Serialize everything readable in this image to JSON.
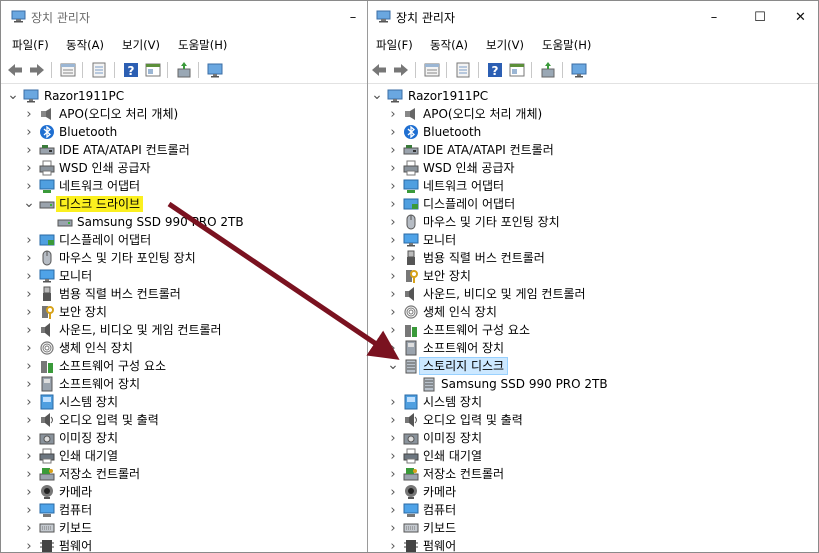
{
  "window": {
    "title": "장치 관리자",
    "menu": [
      "파일(F)",
      "동작(A)",
      "보기(V)",
      "도움말(H)"
    ],
    "controls": {
      "minimize": "–",
      "maximize": "☐",
      "close": "✕"
    }
  },
  "colors": {
    "arrow": "#7a1220",
    "highlight_yellow": "#fbf01f",
    "selection_blue": "#cce8ff"
  },
  "left_tree": {
    "root": "Razor1911PC",
    "items": [
      {
        "label": "APO(오디오 처리 개체)",
        "icon": "audio-processing-icon"
      },
      {
        "label": "Bluetooth",
        "icon": "bluetooth-icon"
      },
      {
        "label": "IDE ATA/ATAPI 컨트롤러",
        "icon": "ide-controller-icon"
      },
      {
        "label": "WSD 인쇄 공급자",
        "icon": "printer-icon"
      },
      {
        "label": "네트워크 어댑터",
        "icon": "network-adapter-icon"
      },
      {
        "label": "디스크 드라이브",
        "icon": "disk-drive-icon",
        "expanded": true,
        "highlight": "yellow"
      },
      {
        "label": "Samsung SSD 990 PRO 2TB",
        "icon": "disk-drive-icon",
        "child": true
      },
      {
        "label": "디스플레이 어댑터",
        "icon": "display-adapter-icon"
      },
      {
        "label": "마우스 및 기타 포인팅 장치",
        "icon": "mouse-icon"
      },
      {
        "label": "모니터",
        "icon": "monitor-icon"
      },
      {
        "label": "범용 직렬 버스 컨트롤러",
        "icon": "usb-controller-icon"
      },
      {
        "label": "보안 장치",
        "icon": "security-device-icon"
      },
      {
        "label": "사운드, 비디오 및 게임 컨트롤러",
        "icon": "sound-icon"
      },
      {
        "label": "생체 인식 장치",
        "icon": "biometric-icon"
      },
      {
        "label": "소프트웨어 구성 요소",
        "icon": "software-component-icon"
      },
      {
        "label": "소프트웨어 장치",
        "icon": "software-device-icon"
      },
      {
        "label": "시스템 장치",
        "icon": "system-device-icon"
      },
      {
        "label": "오디오 입력 및 출력",
        "icon": "audio-io-icon"
      },
      {
        "label": "이미징 장치",
        "icon": "imaging-device-icon"
      },
      {
        "label": "인쇄 대기열",
        "icon": "print-queue-icon"
      },
      {
        "label": "저장소 컨트롤러",
        "icon": "storage-controller-icon"
      },
      {
        "label": "카메라",
        "icon": "camera-icon"
      },
      {
        "label": "컴퓨터",
        "icon": "computer-icon"
      },
      {
        "label": "키보드",
        "icon": "keyboard-icon"
      },
      {
        "label": "펌웨어",
        "icon": "firmware-icon"
      }
    ]
  },
  "right_tree": {
    "root": "Razor1911PC",
    "items": [
      {
        "label": "APO(오디오 처리 개체)",
        "icon": "audio-processing-icon"
      },
      {
        "label": "Bluetooth",
        "icon": "bluetooth-icon"
      },
      {
        "label": "IDE ATA/ATAPI 컨트롤러",
        "icon": "ide-controller-icon"
      },
      {
        "label": "WSD 인쇄 공급자",
        "icon": "printer-icon"
      },
      {
        "label": "네트워크 어댑터",
        "icon": "network-adapter-icon"
      },
      {
        "label": "디스플레이 어댑터",
        "icon": "display-adapter-icon"
      },
      {
        "label": "마우스 및 기타 포인팅 장치",
        "icon": "mouse-icon"
      },
      {
        "label": "모니터",
        "icon": "monitor-icon"
      },
      {
        "label": "범용 직렬 버스 컨트롤러",
        "icon": "usb-controller-icon"
      },
      {
        "label": "보안 장치",
        "icon": "security-device-icon"
      },
      {
        "label": "사운드, 비디오 및 게임 컨트롤러",
        "icon": "sound-icon"
      },
      {
        "label": "생체 인식 장치",
        "icon": "biometric-icon"
      },
      {
        "label": "소프트웨어 구성 요소",
        "icon": "software-component-icon"
      },
      {
        "label": "소프트웨어 장치",
        "icon": "software-device-icon"
      },
      {
        "label": "스토리지 디스크",
        "icon": "storage-disk-icon",
        "expanded": true,
        "highlight": "blue"
      },
      {
        "label": "Samsung SSD 990 PRO 2TB",
        "icon": "storage-disk-icon",
        "child": true
      },
      {
        "label": "시스템 장치",
        "icon": "system-device-icon"
      },
      {
        "label": "오디오 입력 및 출력",
        "icon": "audio-io-icon"
      },
      {
        "label": "이미징 장치",
        "icon": "imaging-device-icon"
      },
      {
        "label": "인쇄 대기열",
        "icon": "print-queue-icon"
      },
      {
        "label": "저장소 컨트롤러",
        "icon": "storage-controller-icon"
      },
      {
        "label": "카메라",
        "icon": "camera-icon"
      },
      {
        "label": "컴퓨터",
        "icon": "computer-icon"
      },
      {
        "label": "키보드",
        "icon": "keyboard-icon"
      },
      {
        "label": "펌웨어",
        "icon": "firmware-icon"
      }
    ]
  }
}
